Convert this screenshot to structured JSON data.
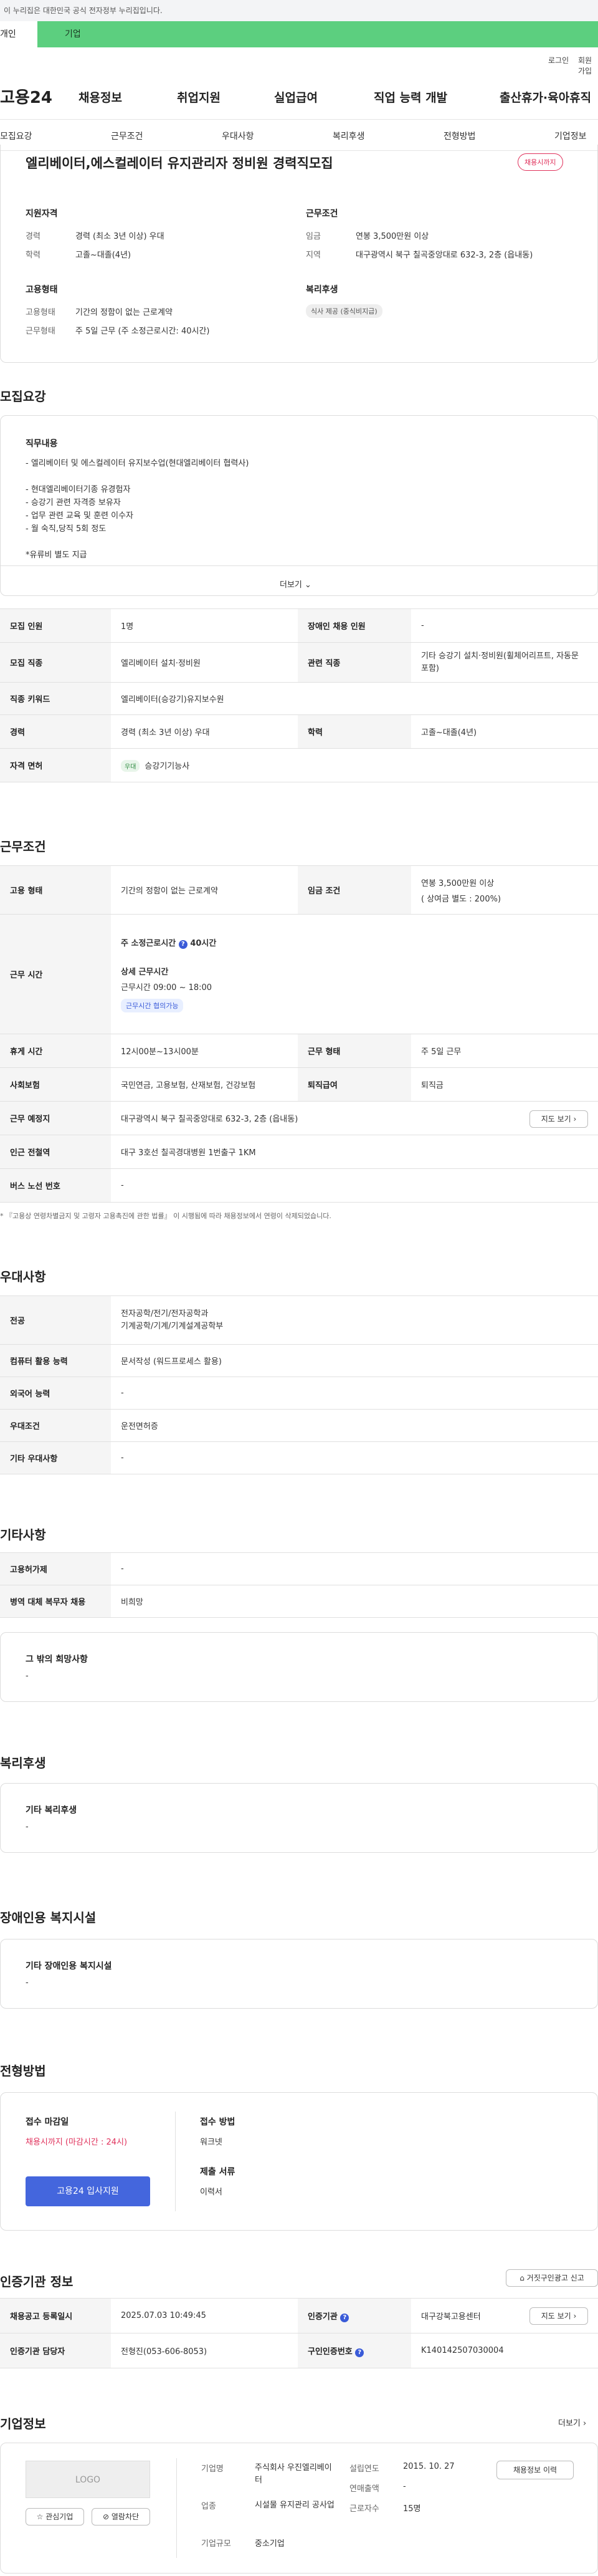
{
  "gov_banner": "이 누리집은 대한민국 공식 전자정부 누리집입니다.",
  "site_tabs": {
    "personal": "개인",
    "corporate": "기업"
  },
  "util": {
    "login": "로그인",
    "join": "회원가입"
  },
  "logo": "고용24",
  "gnb": [
    "채용정보",
    "취업지원",
    "실업급여",
    "직업 능력 개발",
    "출산휴가·육아휴직"
  ],
  "anchor_nav": [
    "모집요강",
    "근무조건",
    "우대사항",
    "복리후생",
    "전형방법",
    "기업정보"
  ],
  "summary": {
    "title": "엘리베이터,에스컬레이터 유지관리자 정비원 경력직모집",
    "status": "채용시까지",
    "qual_head": "지원자격",
    "exp_label": "경력",
    "exp_value": "경력 (최소 3년 이상) 우대",
    "edu_label": "학력",
    "edu_value": "고졸~대졸(4년)",
    "cond_head": "근무조건",
    "wage_label": "임금",
    "wage_value": "연봉 3,500만원 이상",
    "region_label": "지역",
    "region_value": "대구광역시 북구 칠곡중앙대로 632-3, 2층 (읍내동)",
    "emp_head": "고용형태",
    "emptype_label": "고용형태",
    "emptype_value": "기간의 정함이 없는 근로계약",
    "worktype_label": "근무형태",
    "worktype_value": "주 5일 근무 (주 소정근로시간: 40시간)",
    "welfare_head": "복리후생",
    "welfare_value": "식사 제공 (중식비지급)"
  },
  "recruit": {
    "heading": "모집요강",
    "duty_head": "직무내용",
    "duty_text": "- 엘리베이터 및 에스컬레이터 유지보수업(현대엘리베이터 협력사)\n\n- 현대엘리베이터기종 유경험자\n- 승강기 관련 자격증 보유자\n- 업무 관련 교육 및 훈련 이수자\n- 월 숙직,당직 5회 정도\n\n  *유류비 별도 지급",
    "more": "더보기",
    "rows": {
      "count_l": "모집 인원",
      "count_v": "1명",
      "dis_l": "장애인 채용 인원",
      "dis_v": "-",
      "job_l": "모집 직종",
      "job_v": "엘리베이터 설치·정비원",
      "rel_l": "관련 직종",
      "rel_v": "기타 승강기 설치·정비원(휠체어리프트, 자동문 포함)",
      "kw_l": "직종 키워드",
      "kw_v": "엘리베이터(승강기)유지보수원",
      "exp_l": "경력",
      "exp_v": "경력 (최소 3년 이상) 우대",
      "edu_l": "학력",
      "edu_v": "고졸~대졸(4년)",
      "lic_l": "자격 면허",
      "lic_tag": "우대",
      "lic_v": "승강기기능사"
    }
  },
  "work": {
    "heading": "근무조건",
    "emp_l": "고용 형태",
    "emp_v": "기간의 정함이 없는 근로계약",
    "wage_l": "임금 조건",
    "wage_v1": "연봉 3,500만원 이상",
    "wage_v2": "( 상여금 별도 : 200%)",
    "time_l": "근무 시간",
    "std_hours": "주 소정근로시간",
    "std_hours_v": "40시간",
    "detail_head": "상세 근무시간",
    "detail_v": "근무시간 09:00 ~ 18:00",
    "flex": "근무시간 협의가능",
    "rest_l": "휴게 시간",
    "rest_v": "12시00분~13시00분",
    "form_l": "근무 형태",
    "form_v": "주 5일 근무",
    "ins_l": "사회보험",
    "ins_v": "국민연금, 고용보험, 산재보험, 건강보험",
    "ret_l": "퇴직급여",
    "ret_v": "퇴직금",
    "place_l": "근무 예정지",
    "place_v": "대구광역시 북구 칠곡중앙대로 632-3, 2층 (읍내동)",
    "map_btn": "지도 보기",
    "subway_l": "인근 전철역",
    "subway_v": "대구 3호선 칠곡경대병원 1번출구 1KM",
    "bus_l": "버스 노선 번호",
    "bus_v": "-",
    "notice": "* 『고용상 연령차별금지 및 고령자 고용촉진에 관한 법률』 이 시행됨에 따라 채용정보에서 연령이 삭제되었습니다."
  },
  "pref": {
    "heading": "우대사항",
    "major_l": "전공",
    "major_v": "전자공학/전기/전자공학과\n기계공학/기계/기계설계공학부",
    "pc_l": "컴퓨터 활용 능력",
    "pc_v": "문서작성 (워드프로세스 활용)",
    "lang_l": "외국어 능력",
    "lang_v": "-",
    "cond_l": "우대조건",
    "cond_v": "운전면허증",
    "etc_l": "기타 우대사항",
    "etc_v": "-"
  },
  "other": {
    "heading": "기타사항",
    "a_l": "고용허가제",
    "a_v": "-",
    "b_l": "병역 대체 복무자 채용",
    "b_v": "비희망",
    "hope_head": "그 밖의 희망사항",
    "hope_v": "-"
  },
  "welfare": {
    "heading": "복리후생",
    "sub": "기타 복리후생",
    "v": "-"
  },
  "dis": {
    "heading": "장애인용 복지시설",
    "sub": "기타 장애인용 복지시설",
    "v": "-"
  },
  "apply": {
    "heading": "전형방법",
    "deadline_head": "접수 마감일",
    "deadline_v": "채용시까지 (마감시간 : 24시)",
    "apply_btn": "고용24 입사지원",
    "method_head": "접수 방법",
    "method_v": "워크넷",
    "docs_head": "제출 서류",
    "docs_v": "이력서"
  },
  "cert": {
    "heading": "인증기관 정보",
    "report_btn": "거짓구인광고 신고",
    "reg_l": "채용공고 등록일시",
    "reg_v": "2025.07.03 10:49:45",
    "org_l": "인증기관",
    "org_v": "대구강북고용센터",
    "map_btn": "지도 보기",
    "mgr_l": "인증기관 담당자",
    "mgr_v": "전형진(053-606-8053)",
    "id_l": "구인인증번호",
    "id_v": "K140142507030004"
  },
  "company": {
    "heading": "기업정보",
    "more": "더보기",
    "logo": "LOGO",
    "fav": "관심기업",
    "block": "열람차단",
    "name_l": "기업명",
    "name_v": "주식회사 우진엘리베이터",
    "biz_l": "업종",
    "biz_v": "시설물 유지관리 공사업",
    "size_l": "기업규모",
    "size_v": "중소기업",
    "year_l": "설립연도",
    "year_v": "2015. 10. 27",
    "sales_l": "연매출액",
    "sales_v": "-",
    "emp_l": "근로자수",
    "emp_v": "15명",
    "jobs_btn": "채용정보 이력"
  }
}
